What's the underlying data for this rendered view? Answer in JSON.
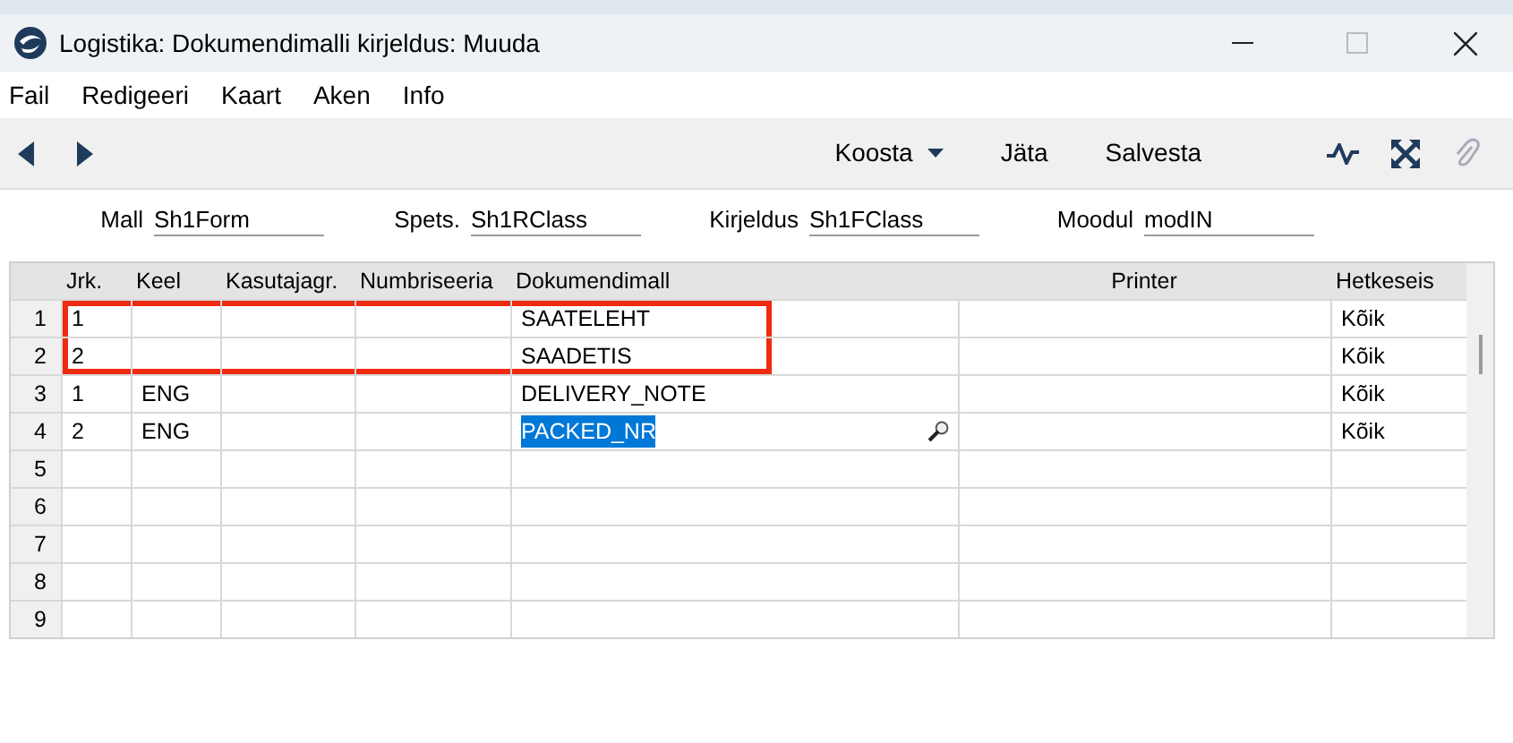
{
  "window": {
    "title": "Logistika: Dokumendimalli kirjeldus: Muuda"
  },
  "menu": [
    "Fail",
    "Redigeeri",
    "Kaart",
    "Aken",
    "Info"
  ],
  "toolbar": {
    "buttons": [
      {
        "label": "Koosta",
        "kind": "dropdown"
      },
      {
        "label": "Jäta",
        "kind": "plain"
      },
      {
        "label": "Salvesta",
        "kind": "plain"
      }
    ]
  },
  "fields": [
    {
      "label": "Mall",
      "value": "Sh1Form"
    },
    {
      "label": "Spets.",
      "value": "Sh1RClass"
    },
    {
      "label": "Kirjeldus",
      "value": "Sh1FClass"
    },
    {
      "label": "Moodul",
      "value": "modIN"
    }
  ],
  "table": {
    "columns": [
      "Jrk.",
      "Keel",
      "Kasutajagr.",
      "Numbriseeria",
      "Dokumendimall",
      "Printer",
      "Hetkeseis"
    ],
    "rows": [
      {
        "number": "1",
        "cells": [
          "1",
          "",
          "",
          "",
          "SAATELEHT",
          "",
          "Kõik"
        ],
        "highlighted": true,
        "selected": false
      },
      {
        "number": "2",
        "cells": [
          "2",
          "",
          "",
          "",
          "SAADETIS",
          "",
          "Kõik"
        ],
        "highlighted": true,
        "selected": false
      },
      {
        "number": "3",
        "cells": [
          "1",
          "ENG",
          "",
          "",
          "DELIVERY_NOTE",
          "",
          "Kõik"
        ],
        "highlighted": false,
        "selected": false
      },
      {
        "number": "4",
        "cells": [
          "2",
          "ENG",
          "",
          "",
          "PACKED_NR",
          "",
          "Kõik"
        ],
        "highlighted": false,
        "selected": true
      },
      {
        "number": "5",
        "cells": [
          "",
          "",
          "",
          "",
          "",
          "",
          ""
        ]
      },
      {
        "number": "6",
        "cells": [
          "",
          "",
          "",
          "",
          "",
          "",
          ""
        ]
      },
      {
        "number": "7",
        "cells": [
          "",
          "",
          "",
          "",
          "",
          "",
          ""
        ]
      },
      {
        "number": "8",
        "cells": [
          "",
          "",
          "",
          "",
          "",
          "",
          ""
        ]
      },
      {
        "number": "9",
        "cells": [
          "",
          "",
          "",
          "",
          "",
          "",
          ""
        ]
      }
    ]
  }
}
